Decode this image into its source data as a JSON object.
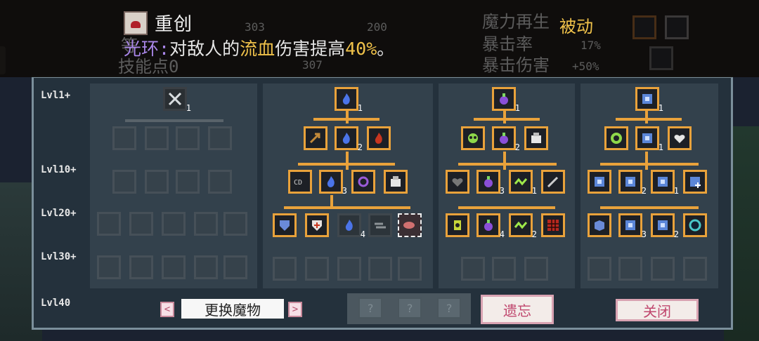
{
  "skill": {
    "name": "重创",
    "desc_kw": "光环:",
    "desc_1": "对敌人的",
    "desc_hl": "流血",
    "desc_2": "伤害提高",
    "desc_pct": "40%",
    "desc_end": "。",
    "type": "被动"
  },
  "ghost_stats": {
    "left_1": "等",
    "left_2": "技能点0",
    "n1": "303",
    "n2": "200",
    "n3": "307",
    "r1": "魔力再生",
    "r2": "暴击率",
    "r2v": "17%",
    "r3": "暴击伤害",
    "r3v": "+50%"
  },
  "levels": [
    "Lvl1+",
    "Lvl10+",
    "Lvl20+",
    "Lvl30+",
    "Lvl40"
  ],
  "tree": {
    "col2": {
      "row1": [
        {
          "n": "1"
        }
      ],
      "row2": [
        {
          "n": ""
        },
        {
          "n": "2"
        },
        {
          "n": ""
        }
      ],
      "row3": [
        {
          "n": ""
        },
        {
          "n": "3"
        },
        {
          "n": ""
        },
        {
          "n": ""
        }
      ],
      "row4": [
        {
          "n": ""
        },
        {
          "n": ""
        },
        {
          "n": "4"
        },
        {
          "n": ""
        },
        {
          "n": ""
        }
      ]
    },
    "col3": {
      "row1": [
        {
          "n": "1"
        }
      ],
      "row2": [
        {
          "n": ""
        },
        {
          "n": "2"
        },
        {
          "n": ""
        }
      ],
      "row3": [
        {
          "n": ""
        },
        {
          "n": "3"
        },
        {
          "n": "1"
        },
        {
          "n": ""
        }
      ],
      "row4": [
        {
          "n": ""
        },
        {
          "n": "4"
        },
        {
          "n": "2"
        },
        {
          "n": ""
        }
      ]
    },
    "col4": {
      "row1": [
        {
          "n": "1"
        }
      ],
      "row2": [
        {
          "n": ""
        },
        {
          "n": "1"
        },
        {
          "n": ""
        }
      ],
      "row3": [
        {
          "n": ""
        },
        {
          "n": "2"
        },
        {
          "n": "1"
        },
        {
          "n": ""
        }
      ],
      "row4": [
        {
          "n": ""
        },
        {
          "n": "3"
        },
        {
          "n": "2"
        },
        {
          "n": ""
        }
      ]
    },
    "col1": {
      "top_n": "1"
    }
  },
  "buttons": {
    "swap": "更换魔物",
    "forget": "遗忘",
    "close": "关闭",
    "q": "?",
    "prev": "<",
    "next": ">"
  },
  "colors": {
    "gold": "#e9a23b",
    "purple_kw": "#a986e8",
    "yellow_hl": "#f0c24a"
  }
}
